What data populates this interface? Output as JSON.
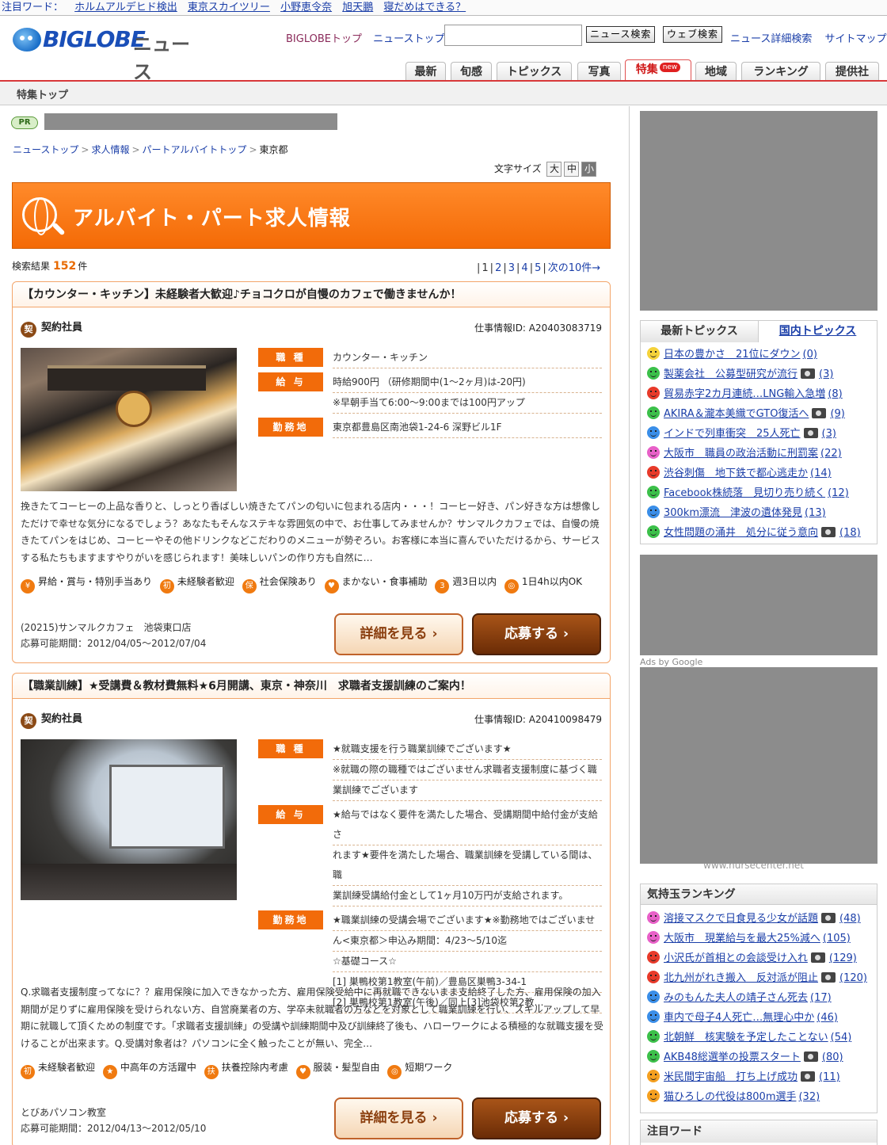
{
  "hotwords": {
    "label": "注目ワード：",
    "items": [
      "ホルムアルデヒド検出",
      "東京スカイツリー",
      "小野恵令奈",
      "旭天鵬",
      "寝だめはできる？"
    ]
  },
  "header": {
    "brand": "BIGLOBE",
    "brand_sub": "ニュース",
    "links": [
      "BIGLOBEトップ",
      "ニューストップ"
    ],
    "search_value": "",
    "news_search_button": "ニュース検索",
    "web_search_button": "ウェブ検索",
    "right_links": [
      "ニュース詳細検索",
      "サイトマップ"
    ]
  },
  "tabs": [
    {
      "label": "最新"
    },
    {
      "label": "旬感"
    },
    {
      "label": "トピックス"
    },
    {
      "label": "写真"
    },
    {
      "label": "特集",
      "badge": "new",
      "active": true
    },
    {
      "label": "地域"
    },
    {
      "label": "ランキング"
    },
    {
      "label": "提供社"
    }
  ],
  "subnav": {
    "label": "特集トップ"
  },
  "pr": {
    "badge": "PR"
  },
  "breadcrumb": [
    "ニューストップ",
    "求人情報",
    "パートアルバイトトップ",
    "東京都"
  ],
  "font_size": {
    "label": "文字サイズ",
    "large": "大",
    "medium": "中",
    "small": "小"
  },
  "banner": {
    "title": "アルバイト・パート求人情報"
  },
  "results": {
    "label": "検索結果",
    "count": "152",
    "unit": "件"
  },
  "pager": {
    "pages": [
      "1",
      "2",
      "3",
      "4",
      "5"
    ],
    "current": "1",
    "next": "次の10件→"
  },
  "jobs": [
    {
      "title": "【カウンター・キッチン】未経験者大歓迎♪チョコクロが自慢のカフェで働きませんか！",
      "type_icon": "契",
      "type": "契約社員",
      "job_id": "仕事情報ID: A20403083719",
      "labels": {
        "kind": "職 種",
        "pay": "給 与",
        "place": "勤務地"
      },
      "kind": [
        "カウンター・キッチン"
      ],
      "pay": [
        "時給900円 （研修期間中(1〜2ヶ月)は-20円)",
        "※早朝手当て6:00〜9:00までは100円アップ"
      ],
      "place": [
        "東京都豊島区南池袋1-24-6 深野ビル1F"
      ],
      "description": "挽きたてコーヒーの上品な香りと、しっとり香ばしい焼きたてパンの匂いに包まれる店内・・・！コーヒー好き、パン好きな方は想像しただけで幸せな気分になるでしょう？あなたもそんなステキな雰囲気の中で、お仕事してみませんか？サンマルクカフェでは、自慢の焼きたてパンをはじめ、コーヒーやその他ドリンクなどこだわりのメニューが勢ぞろい。お客様に本当に喜んでいただけるから、サービスする私たちもますますやりがいを感じられます！美味しいパンの作り方も自然に…",
      "tags": [
        {
          "icon": "¥",
          "label": "昇給・賞与・特別手当あり"
        },
        {
          "icon": "初",
          "label": "未経験者歓迎"
        },
        {
          "icon": "保",
          "label": "社会保険あり"
        },
        {
          "icon": "♥",
          "label": "まかない・食事補助"
        },
        {
          "icon": "3",
          "label": "週3日以内"
        },
        {
          "icon": "◎",
          "label": "1日4h以内OK"
        }
      ],
      "shop": "(20215)サンマルクカフェ　池袋東口店",
      "period": "応募可能期間：2012/04/05〜2012/07/04",
      "detail_button": "詳細を見る ›",
      "apply_button": "応募する ›"
    },
    {
      "title": "【職業訓練】★受講費＆教材費無料★6月開講、東京・神奈川　求職者支援訓練のご案内！",
      "type_icon": "契",
      "type": "契約社員",
      "job_id": "仕事情報ID: A20410098479",
      "labels": {
        "kind": "職 種",
        "pay": "給 与",
        "place": "勤務地"
      },
      "kind": [
        "★就職支援を行う職業訓練でございます★",
        "※就職の際の職種ではございません求職者支援制度に基づく職",
        "業訓練でございます"
      ],
      "pay": [
        "★給与ではなく要件を満たした場合、受講期間中給付金が支給さ",
        "れます★要件を満たした場合、職業訓練を受講している間は、職",
        "業訓練受講給付金として1ヶ月10万円が支給されます。"
      ],
      "place": [
        "★職業訓練の受講会場でございます★※勤務地ではございませ",
        "ん<東京都＞申込み期間：4/23〜5/10迄",
        "☆基礎コース☆",
        "[1] 巣鴨校第1教室(午前)／豊島区巣鴨3-34-1",
        "[2] 巣鴨校第1教室(午後)／同上[3]池袋校第2教…"
      ],
      "description": "Q.求職者支援制度ってなに？？雇用保険に加入できなかった方、雇用保険受給中に再就職できないまま支給終了した方、雇用保険の加入期間が足りずに雇用保険を受けられない方、自営廃業者の方、学卒未就職者の方などを対象として職業訓練を行い、スキルアップして早期に就職して頂くための制度です。「求職者支援訓練」の受講や訓練期間中及び訓練終了後も、ハローワークによる積極的な就職支援を受けることが出来ます。Q.受講対象者は？パソコンに全く触ったことが無い、完全…",
      "tags": [
        {
          "icon": "初",
          "label": "未経験者歓迎"
        },
        {
          "icon": "★",
          "label": "中高年の方活躍中"
        },
        {
          "icon": "扶",
          "label": "扶養控除内考慮"
        },
        {
          "icon": "♥",
          "label": "服装・髪型自由"
        },
        {
          "icon": "◎",
          "label": "短期ワーク"
        }
      ],
      "shop": "とびあパソコン教室",
      "period": "応募可能期間：2012/04/13〜2012/05/10",
      "detail_button": "詳細を見る ›",
      "apply_button": "応募する ›"
    }
  ],
  "topics": {
    "tab_latest": "最新トピックス",
    "tab_domestic": "国内トピックス",
    "items": [
      {
        "text": "日本の豊かさ　21位にダウン",
        "count": "(0)",
        "photo": false,
        "face": "#f5d23a"
      },
      {
        "text": "製薬会社　公募型研究が流行",
        "count": "(3)",
        "photo": true,
        "face": "#3cc04a"
      },
      {
        "text": "貿易赤字2カ月連続…LNG輸入急増",
        "count": "(8)",
        "photo": false,
        "face": "#e83a2a"
      },
      {
        "text": "AKIRA＆瀧本美織でGTO復活へ",
        "count": "(9)",
        "photo": true,
        "face": "#3cc04a"
      },
      {
        "text": "インドで列車衝突　25人死亡",
        "count": "(3)",
        "photo": true,
        "face": "#3a8ee8"
      },
      {
        "text": "大阪市　職員の政治活動に刑罰案",
        "count": "(22)",
        "photo": false,
        "face": "#e860c8"
      },
      {
        "text": "渋谷刺傷　地下鉄で都心逃走か",
        "count": "(14)",
        "photo": false,
        "face": "#e83a2a"
      },
      {
        "text": "Facebook株続落　見切り売り続く",
        "count": "(12)",
        "photo": false,
        "face": "#3cc04a"
      },
      {
        "text": "300km漂流　津波の遺体発見",
        "count": "(13)",
        "photo": false,
        "face": "#3a8ee8"
      },
      {
        "text": "女性問題の涌井　処分に従う意向",
        "count": "(18)",
        "photo": true,
        "face": "#3cc04a"
      }
    ]
  },
  "ads": {
    "ads_by": "Ads by Google",
    "url": "www.nursecenter.net"
  },
  "ranking": {
    "title": "気持玉ランキング",
    "items": [
      {
        "text": "溶接マスクで日食見る少女が話題",
        "count": "(48)",
        "photo": true,
        "face": "#e860c8"
      },
      {
        "text": "大阪市　現業給与を最大25%減へ",
        "count": "(105)",
        "photo": false,
        "face": "#e860c8"
      },
      {
        "text": "小沢氏が首相との会談受け入れ",
        "count": "(129)",
        "photo": true,
        "face": "#e83a2a"
      },
      {
        "text": "北九州がれき搬入　反対派が阻止",
        "count": "(120)",
        "photo": true,
        "face": "#e83a2a"
      },
      {
        "text": "みのもんた夫人の靖子さん死去",
        "count": "(17)",
        "photo": false,
        "face": "#3a8ee8"
      },
      {
        "text": "車内で母子4人死亡…無理心中か",
        "count": "(46)",
        "photo": false,
        "face": "#3a8ee8"
      },
      {
        "text": "北朝鮮　核実験を予定したことない",
        "count": "(54)",
        "photo": false,
        "face": "#3cc04a"
      },
      {
        "text": "AKB48総選挙の投票スタート",
        "count": "(80)",
        "photo": true,
        "face": "#3cc04a"
      },
      {
        "text": "米民間宇宙船　打ち上げ成功",
        "count": "(11)",
        "photo": true,
        "face": "#f5a020"
      },
      {
        "text": "猫ひろしの代役は800m選手",
        "count": "(32)",
        "photo": false,
        "face": "#f5a020"
      }
    ]
  },
  "attention": {
    "title": "注目ワード"
  }
}
